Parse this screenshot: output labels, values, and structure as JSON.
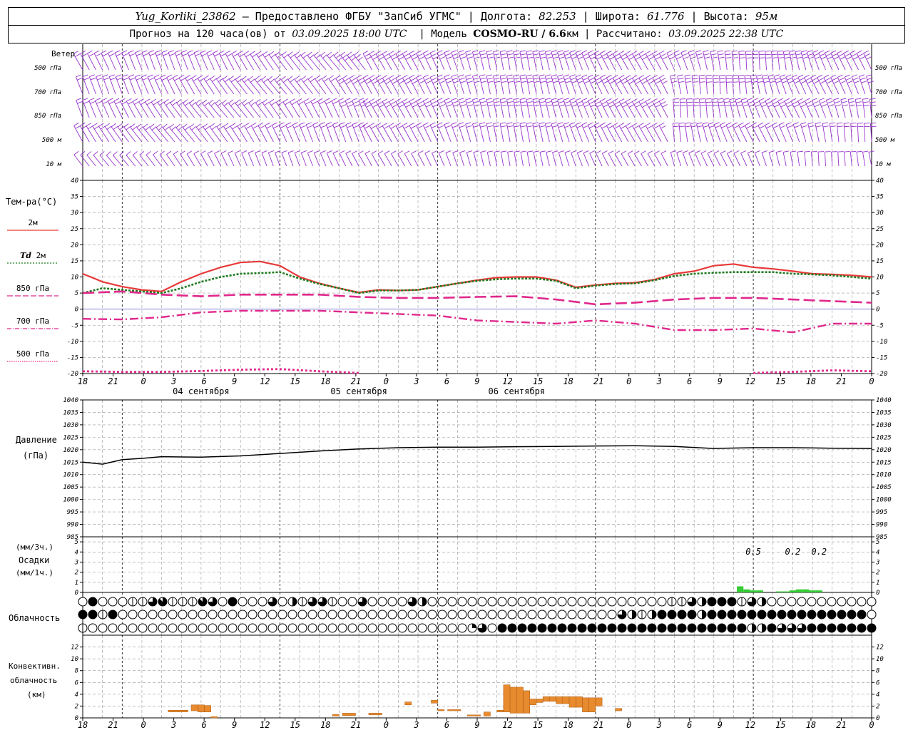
{
  "header": {
    "station": "Yug_Korliki_23862",
    "provider": " – Предоставлено ФГБУ \"ЗапСиб УГМС\" | Долгота: ",
    "lon": "82.253",
    "lat_label": " | Широта: ",
    "lat": "61.776",
    "alt_label": " | Высота: ",
    "alt": "95м",
    "forecast_label": "Прогноз на 120 часа(ов) от ",
    "forecast_start": "03.09.2025 18:00 UTC",
    "model_label": "  | Модель ",
    "model": "COSMO-RU / 6.6",
    "model_unit": "км",
    "calc_label": " | Рассчитано: ",
    "calc_time": "03.09.2025 22:38 UTC"
  },
  "labels": {
    "wind_title": "Ветер",
    "wind_levels": [
      "500 гПа",
      "700 гПа",
      "850 гПа",
      "500 м",
      "10  м"
    ],
    "temp_title": "Тем-ра(°C)",
    "temp_2m": "2м",
    "td_prefix": "Td",
    "td_2m": "2м",
    "t850": "850 гПа",
    "t700": "700 гПа",
    "t500": "500 гПа",
    "pressure_title": "Давление",
    "pressure_unit": "(гПа)",
    "precip_unit3": "(мм/3ч.)",
    "precip_title": "Осадки",
    "precip_unit1": "(мм/1ч.)",
    "cloud_title": "Облачность",
    "conv_line1": "Конвективн.",
    "conv_line2": "облачность",
    "conv_line3": "(км)"
  },
  "time_axis": {
    "hour_labels": [
      "18",
      "21",
      "0",
      "3",
      "6",
      "9",
      "12",
      "15",
      "18",
      "21",
      "0",
      "3",
      "6",
      "9",
      "12",
      "15",
      "18",
      "21",
      "0",
      "3",
      "6",
      "9",
      "12",
      "15",
      "18",
      "21",
      "0"
    ],
    "date_labels": [
      "04 сентября",
      "05 сентября",
      "06 сентября"
    ]
  },
  "colors": {
    "wind": "#9933cc",
    "t2m": "#e83a3a",
    "td2m": "#1e7a1e",
    "t_upper": "#e0288c",
    "pressure": "#000000",
    "precip": "#33cc33",
    "conv": "#e88a2e",
    "grid": "#999999"
  },
  "chart_data": [
    {
      "type": "line",
      "title": "Тем-ра(°C)",
      "x_unit": "hours from 03.09.2025 18:00 UTC",
      "ylim": [
        -20,
        40
      ],
      "yticks": [
        -20,
        -15,
        -10,
        -5,
        0,
        5,
        10,
        15,
        20,
        25,
        30,
        35,
        40
      ],
      "series": [
        {
          "name": "2м",
          "x": [
            0,
            3,
            6,
            9,
            12,
            15,
            18,
            21,
            24,
            27,
            30,
            33,
            36,
            39,
            42,
            45,
            48,
            51,
            54,
            57,
            60,
            63,
            66,
            69,
            72,
            75,
            78,
            81,
            84,
            87,
            90,
            93,
            96,
            99,
            102,
            105,
            108,
            111,
            114,
            117,
            120
          ],
          "values": [
            11,
            8.5,
            7,
            6,
            5.5,
            8.5,
            11,
            13,
            14.5,
            14.8,
            13.5,
            10,
            8,
            6.5,
            5.2,
            6,
            5.8,
            6,
            7,
            8,
            9,
            9.8,
            10,
            10,
            9,
            6.8,
            7.5,
            8,
            8.2,
            9.2,
            11,
            11.8,
            13.5,
            14,
            13,
            12.5,
            11.8,
            11,
            10.8,
            10.5,
            10
          ]
        },
        {
          "name": "Td 2м",
          "x": [
            0,
            3,
            6,
            9,
            12,
            15,
            18,
            21,
            24,
            27,
            30,
            33,
            36,
            39,
            42,
            45,
            48,
            51,
            54,
            57,
            60,
            63,
            66,
            69,
            72,
            75,
            78,
            81,
            84,
            87,
            90,
            93,
            96,
            99,
            102,
            105,
            108,
            111,
            114,
            117,
            120
          ],
          "values": [
            5,
            6.5,
            6,
            5.5,
            5,
            6.5,
            8.5,
            10,
            11,
            11.2,
            11.5,
            9.5,
            7.8,
            6.5,
            5,
            5.8,
            5.8,
            6,
            7,
            8,
            8.8,
            9.3,
            9.5,
            9.5,
            8.8,
            6.5,
            7.3,
            7.8,
            8,
            9,
            10.3,
            11,
            11.3,
            11.5,
            11.5,
            11.5,
            11,
            10.8,
            10.5,
            10,
            9.5
          ]
        },
        {
          "name": "850 гПа",
          "x": [
            0,
            6,
            12,
            18,
            24,
            30,
            36,
            42,
            48,
            54,
            60,
            66,
            72,
            78,
            84,
            90,
            96,
            102,
            108,
            114,
            120
          ],
          "values": [
            5,
            5.5,
            4.5,
            4,
            4.5,
            4.5,
            4.5,
            3.8,
            3.5,
            3.5,
            3.8,
            4,
            3,
            1.5,
            2,
            3,
            3.5,
            3.5,
            3,
            2.5,
            2
          ]
        },
        {
          "name": "700 гПа",
          "x": [
            0,
            6,
            12,
            18,
            24,
            30,
            36,
            42,
            48,
            54,
            60,
            66,
            72,
            78,
            84,
            90,
            96,
            102,
            108,
            114,
            120
          ],
          "values": [
            -3,
            -3.2,
            -2.5,
            -1,
            -0.5,
            -0.5,
            -0.5,
            -1,
            -1.5,
            -2,
            -3.5,
            -4,
            -4.5,
            -3.5,
            -4.5,
            -6.5,
            -6.5,
            -6,
            -7.2,
            -4.5,
            -4.5
          ]
        },
        {
          "name": "500 гПа",
          "x": [
            0,
            6,
            12,
            18,
            24,
            30,
            36,
            42,
            54,
            60,
            66,
            72,
            78,
            84,
            90,
            96,
            100,
            102,
            108,
            114,
            120
          ],
          "values": [
            -19.3,
            -19.5,
            -19.5,
            -19.2,
            -18.8,
            -18.6,
            -19.3,
            -19.8,
            null,
            null,
            null,
            null,
            null,
            null,
            null,
            null,
            null,
            -19.8,
            -19.5,
            -19,
            -19.3
          ]
        }
      ]
    },
    {
      "type": "line",
      "title": "Давление",
      "ylabel": "(гПа)",
      "ylim": [
        985,
        1040
      ],
      "yticks": [
        985,
        990,
        995,
        1000,
        1005,
        1010,
        1015,
        1020,
        1025,
        1030,
        1035,
        1040
      ],
      "series": [
        {
          "name": "Давление",
          "x": [
            0,
            3,
            6,
            9,
            12,
            18,
            24,
            30,
            36,
            42,
            48,
            54,
            60,
            66,
            72,
            78,
            84,
            90,
            96,
            102,
            108,
            114,
            120
          ],
          "values": [
            1015,
            1014.2,
            1016,
            1016.5,
            1017.2,
            1017,
            1017.5,
            1018.5,
            1019.5,
            1020.3,
            1020.8,
            1021,
            1021,
            1021.2,
            1021.3,
            1021.5,
            1021.6,
            1021.3,
            1020.5,
            1020.8,
            1020.8,
            1020.6,
            1020.5
          ]
        }
      ]
    },
    {
      "type": "bar",
      "title": "Осадки",
      "ylabel": "(мм/1ч.)",
      "ylim": [
        0,
        5
      ],
      "yticks": [
        0,
        1,
        2,
        3,
        4,
        5
      ],
      "bars": [
        {
          "x": 100,
          "value": 0.6
        },
        {
          "x": 101,
          "value": 0.3
        },
        {
          "x": 102,
          "value": 0.2
        },
        {
          "x": 103,
          "value": 0.2
        },
        {
          "x": 106,
          "value": 0.1
        },
        {
          "x": 107,
          "value": 0.1
        },
        {
          "x": 108,
          "value": 0.2
        },
        {
          "x": 109,
          "value": 0.3
        },
        {
          "x": 110,
          "value": 0.3
        },
        {
          "x": 111,
          "value": 0.2
        },
        {
          "x": 112,
          "value": 0.2
        }
      ],
      "totals_3h": [
        {
          "x": 102,
          "label": "0.5"
        },
        {
          "x": 108,
          "label": "0.2"
        },
        {
          "x": 112,
          "label": "0.2"
        }
      ]
    },
    {
      "type": "bar",
      "title": "Конвективн. облачность",
      "ylabel": "(км)",
      "ylim": [
        0,
        13
      ],
      "yticks": [
        0,
        2,
        4,
        6,
        8,
        10,
        12
      ],
      "bars": [
        {
          "x": 14.5,
          "base": 1,
          "top": 1.3,
          "w": 3
        },
        {
          "x": 17,
          "base": 1.2,
          "top": 2.2,
          "w": 1
        },
        {
          "x": 18,
          "base": 1,
          "top": 2.2,
          "w": 1
        },
        {
          "x": 19,
          "base": 1,
          "top": 2.1,
          "w": 1
        },
        {
          "x": 20,
          "base": 0,
          "top": 0.2,
          "w": 1
        },
        {
          "x": 38.5,
          "base": 0.3,
          "top": 0.6,
          "w": 1
        },
        {
          "x": 40.5,
          "base": 0.4,
          "top": 0.8,
          "w": 2
        },
        {
          "x": 44.5,
          "base": 0.5,
          "top": 0.8,
          "w": 2
        },
        {
          "x": 49.5,
          "base": 2.2,
          "top": 2.7,
          "w": 1
        },
        {
          "x": 53.5,
          "base": 2.5,
          "top": 3,
          "w": 1
        },
        {
          "x": 54.5,
          "base": 1.2,
          "top": 1.4,
          "w": 1
        },
        {
          "x": 56.5,
          "base": 1.2,
          "top": 1.4,
          "w": 2
        },
        {
          "x": 59.5,
          "base": 0.3,
          "top": 0.5,
          "w": 2
        },
        {
          "x": 61.5,
          "base": 0.3,
          "top": 1,
          "w": 1
        },
        {
          "x": 63.5,
          "base": 1,
          "top": 1.3,
          "w": 1
        },
        {
          "x": 64.5,
          "base": 1,
          "top": 5.6,
          "w": 1
        },
        {
          "x": 65.5,
          "base": 0.8,
          "top": 5.2,
          "w": 1
        },
        {
          "x": 66.5,
          "base": 0.8,
          "top": 5.2,
          "w": 1
        },
        {
          "x": 67.5,
          "base": 0.8,
          "top": 4.6,
          "w": 1
        },
        {
          "x": 68.5,
          "base": 2.2,
          "top": 3.2,
          "w": 1
        },
        {
          "x": 69.5,
          "base": 2.6,
          "top": 3.2,
          "w": 1
        },
        {
          "x": 70.5,
          "base": 2.8,
          "top": 3.6,
          "w": 1
        },
        {
          "x": 71.5,
          "base": 2.8,
          "top": 3.6,
          "w": 1
        },
        {
          "x": 72.5,
          "base": 2.4,
          "top": 3.6,
          "w": 1
        },
        {
          "x": 73.5,
          "base": 2.4,
          "top": 3.6,
          "w": 1
        },
        {
          "x": 74.5,
          "base": 1.8,
          "top": 3.6,
          "w": 1
        },
        {
          "x": 75.5,
          "base": 1.8,
          "top": 3.6,
          "w": 1
        },
        {
          "x": 76.5,
          "base": 1,
          "top": 3.4,
          "w": 1
        },
        {
          "x": 77.5,
          "base": 1,
          "top": 3.4,
          "w": 1
        },
        {
          "x": 78.5,
          "base": 2,
          "top": 3.4,
          "w": 1
        },
        {
          "x": 81.5,
          "base": 1.2,
          "top": 1.6,
          "w": 1
        }
      ]
    }
  ],
  "cloud_rows": {
    "levels": [
      "high",
      "middle",
      "low"
    ],
    "glyph_names": [
      "clear",
      "few",
      "scattered",
      "half",
      "broken",
      "mostly",
      "overcast"
    ],
    "high": "0600011451115406000403144100400004300000000000000000000000011436661430000000000000000000000000000000000000000000000010256166633645333",
    "middle": "6616000000000000000000000000000000000000000000000000004313666636666666666666666000000000000000000000000000000000066666656666666634",
    "low": "1000000000000000000000000000000000000002406666666666666666666666666336444666666666666666666666666666661000000000000516666666666666661666666"
  }
}
